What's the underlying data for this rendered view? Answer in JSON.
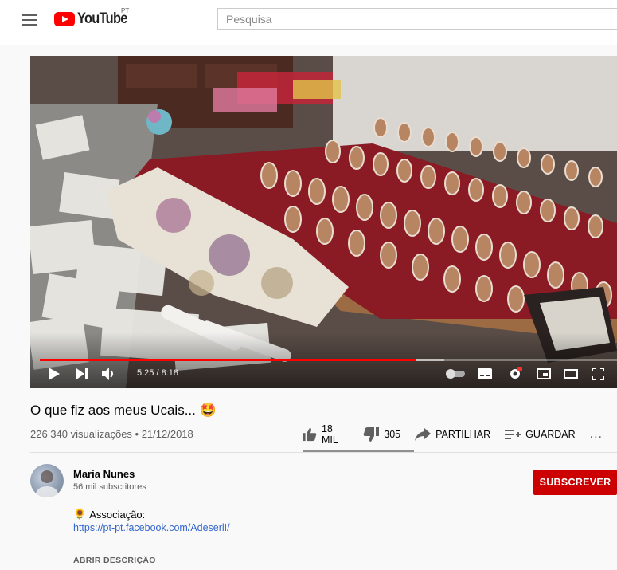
{
  "header": {
    "logo_text": "YouTube",
    "country_code": "PT",
    "search_placeholder": "Pesquisa"
  },
  "player": {
    "time_display": "5:25 / 8:18",
    "progress_fraction": 0.653,
    "colors": {
      "progress": "#ff0000"
    }
  },
  "video": {
    "title": "O que fiz aos meus Ucais...",
    "title_emoji": "🤩",
    "views_line": "226 340 visualizações • 21/12/2018",
    "like_count": "18 MIL",
    "dislike_count": "305",
    "share_label": "PARTILHAR",
    "save_label": "GUARDAR",
    "more_label": "..."
  },
  "channel": {
    "name": "Maria Nunes",
    "subscribers": "56 mil subscritores",
    "subscribe_label": "SUBSCREVER"
  },
  "description": {
    "line1_emoji": "🌻",
    "line1": "Associação:",
    "link": "https://pt-pt.facebook.com/AdeserlI/",
    "show_more": "ABRIR DESCRIÇÃO"
  }
}
